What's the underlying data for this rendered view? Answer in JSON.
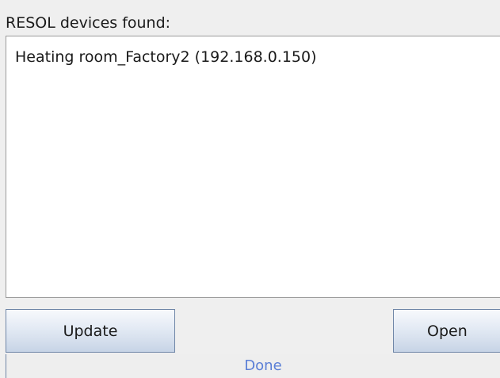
{
  "header": {
    "label": "RESOL devices found:"
  },
  "device_list": {
    "items": [
      {
        "label": "Heating room_Factory2 (192.168.0.150)"
      }
    ]
  },
  "buttons": {
    "update_label": "Update",
    "open_label": "Open"
  },
  "status": {
    "text": "Done",
    "color": "#5b7fd6"
  }
}
